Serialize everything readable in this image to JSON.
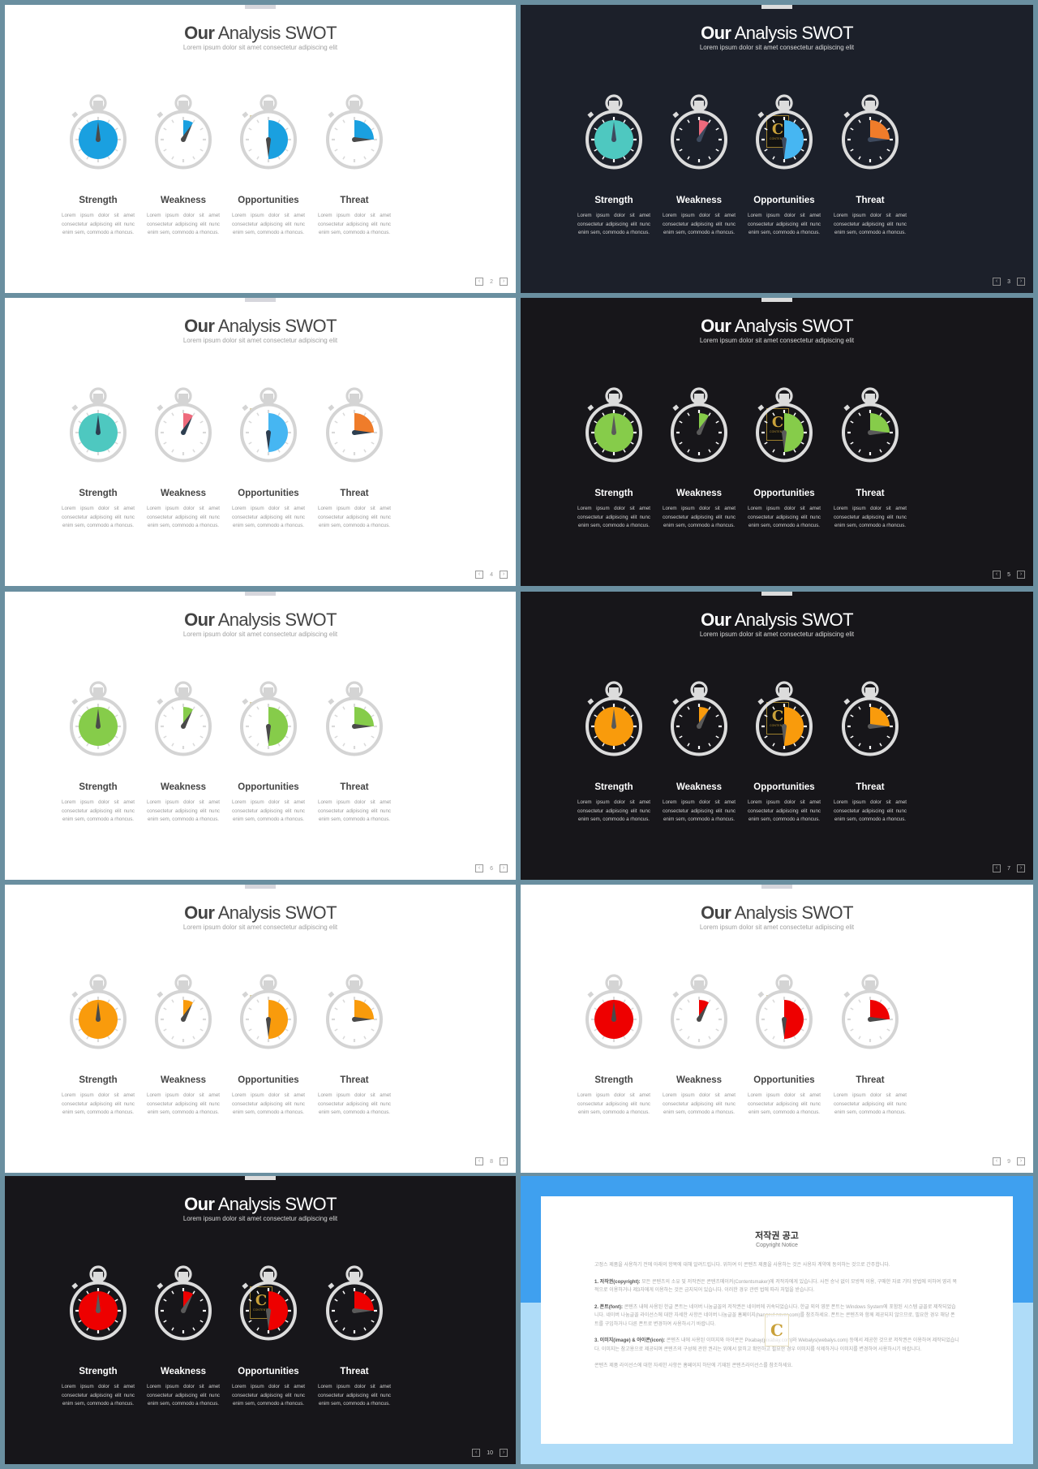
{
  "common": {
    "title_bold": "Our",
    "title_rest": " Analysis SWOT",
    "subtitle": "Lorem ipsum dolor sit amet consectetur adipiscing elit",
    "logo_letter": "C",
    "logo_text": "CONTENTS",
    "prev_icon": "‹",
    "next_icon": "›",
    "items": [
      {
        "label": "Strength",
        "fraction": 1.0,
        "desc": "Lorem ipsum dolor sit amet consectetur adipiscing elit nunc enim sem, commodo a rhoncus."
      },
      {
        "label": "Weakness",
        "fraction": 0.0833,
        "desc": "Lorem ipsum dolor sit amet consectetur adipiscing elit nunc enim sem, commodo a rhoncus."
      },
      {
        "label": "Opportunities",
        "fraction": 0.5,
        "desc": "Lorem ipsum dolor sit amet consectetur adipiscing elit nunc enim sem, commodo a rhoncus."
      },
      {
        "label": "Threat",
        "fraction": 0.25,
        "desc": "Lorem ipsum dolor sit amet consectetur adipiscing elit nunc enim sem, commodo a rhoncus."
      }
    ]
  },
  "slides": [
    {
      "page": "2",
      "theme": "light",
      "bg": "#ffffff",
      "needle": "#4a4a4a",
      "colors": [
        "#1aa0e0",
        "#1aa0e0",
        "#1aa0e0",
        "#1aa0e0"
      ]
    },
    {
      "page": "3",
      "theme": "dark",
      "bg": "#1c202a",
      "needle": "#3e4a5e",
      "colors": [
        "#4ec8c0",
        "#ee6a7c",
        "#46b6f2",
        "#ef7c2a"
      ]
    },
    {
      "page": "4",
      "theme": "light",
      "bg": "#ffffff",
      "needle": "#2d3e50",
      "colors": [
        "#4ec8c0",
        "#ee6a7c",
        "#46b6f2",
        "#ef7c2a"
      ]
    },
    {
      "page": "5",
      "theme": "dark",
      "bg": "#17161a",
      "needle": "#5a5a5a",
      "colors": [
        "#86cc4a",
        "#86cc4a",
        "#86cc4a",
        "#86cc4a"
      ]
    },
    {
      "page": "6",
      "theme": "light",
      "bg": "#ffffff",
      "needle": "#4a4a4a",
      "colors": [
        "#86cc4a",
        "#86cc4a",
        "#86cc4a",
        "#86cc4a"
      ]
    },
    {
      "page": "7",
      "theme": "dark",
      "bg": "#17161a",
      "needle": "#5a5a5a",
      "colors": [
        "#f99b0c",
        "#f99b0c",
        "#f99b0c",
        "#f99b0c"
      ]
    },
    {
      "page": "8",
      "theme": "light",
      "bg": "#ffffff",
      "needle": "#4a4a4a",
      "colors": [
        "#f99b0c",
        "#f99b0c",
        "#f99b0c",
        "#f99b0c"
      ]
    },
    {
      "page": "9",
      "theme": "light",
      "bg": "#ffffff",
      "needle": "#4a4a4a",
      "colors": [
        "#ee0000",
        "#ee0000",
        "#ee0000",
        "#ee0000"
      ]
    },
    {
      "page": "10",
      "theme": "dark",
      "bg": "#17161a",
      "needle": "#5a5a5a",
      "colors": [
        "#ee0000",
        "#ee0000",
        "#ee0000",
        "#ee0000"
      ]
    }
  ],
  "copyright": {
    "title": "저작권 공고",
    "subtitle": "Copyright Notice",
    "logo_letter": "C",
    "intro": "고정스 제품을 사용하기 전에 아래의 항목에 대해 알려드립니다. 위하여 이 콘텐츠 제품을 사용하는 것은 사용자 계약에 동의하는 것으로 간주합니다.",
    "sections": [
      {
        "heading": "1. 저작권(copyright):",
        "text": "모든 콘텐츠의 소유 및 저작권은 콘텐츠메이커(Contentsmaker)에 저작자에게 있습니다. 사전 승낙 없이 모방적 이용, 구매한 자료 기타 방법에 의하여 영리 목적으로 이용하거나 제3자에게 이용하는 것은 금지되어 있습니다. 이러한 경우 관련 법에 따라 처벌을 받습니다."
      },
      {
        "heading": "2. 폰트(font):",
        "text": "콘텐츠 내에 사용된 한글 폰트는 네이버 나눔글꼴의 저작권은 네이버에 귀속되었습니다. 한글 외의 영문 폰트는 Windows System에 포함된 시스템 글꼴로 제작되었습니다. 네이버 나눔글꼴 라이선스에 대한 자세한 사항은 네이버 나눔글꼴 홈페이지(hangeul.naver.com)를 참조하세요. 폰트는 콘텐츠와 함께 제공되지 않으므로, 필요한 경우 해당 폰트를 구입하거나 다른 폰트로 변경하여 사용하시기 바랍니다."
      },
      {
        "heading": "3. 이미지(image) & 아이콘(icon):",
        "text": "콘텐츠 내에 사용된 이미지와 아이콘은 Pixabay(pixabay.com)와 Webalys(webalys.com) 등에서 제공한 것으로 저작권은 이용하여 제작되었습니다. 이미지는 참고용으로 제공되며 콘텐츠의 구성에 관한 권리는 위에서 밝히고 확인하고 필요한 경우 이미지를 삭제하거나 이미지를 변경하여 사용하시기 바랍니다."
      }
    ],
    "outro": "콘텐츠 제품 라이선스에 대한 자세한 사항은 홈페이지 하단에 기재된 콘텐츠라이선스를 참조하세요."
  }
}
